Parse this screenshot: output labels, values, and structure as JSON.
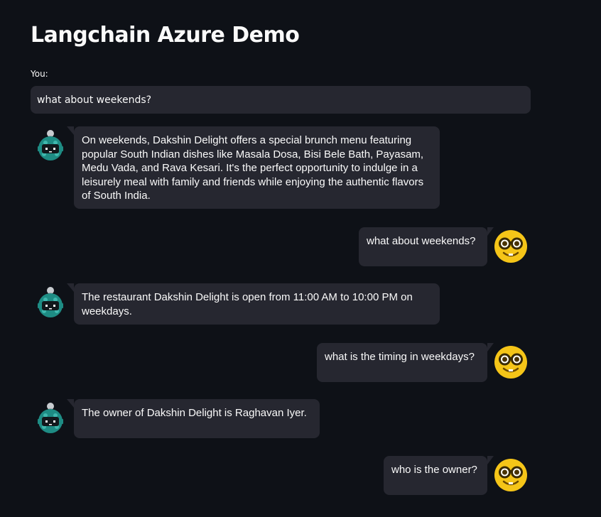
{
  "app": {
    "title": "Langchain Azure Demo"
  },
  "input": {
    "label": "You:",
    "value": "what about weekends?"
  },
  "colors": {
    "background": "#0e1117",
    "bubble": "#262730",
    "text": "#fafafa",
    "bot_avatar": "#1e8c84",
    "user_avatar": "#f5c518"
  },
  "messages": [
    {
      "role": "bot",
      "avatar_icon": "robot-icon",
      "text": "On weekends, Dakshin Delight offers a special brunch menu featuring popular South Indian dishes like Masala Dosa, Bisi Bele Bath, Payasam, Medu Vada, and Rava Kesari. It's the perfect opportunity to indulge in a leisurely meal with family and friends while enjoying the authentic flavors of South India."
    },
    {
      "role": "user",
      "avatar_icon": "nerd-face-icon",
      "text": "what about weekends?"
    },
    {
      "role": "bot",
      "avatar_icon": "robot-icon",
      "text": "The restaurant Dakshin Delight is open from 11:00 AM to 10:00 PM on weekdays."
    },
    {
      "role": "user",
      "avatar_icon": "nerd-face-icon",
      "text": "what is the timing in weekdays?"
    },
    {
      "role": "bot",
      "avatar_icon": "robot-icon",
      "text": "The owner of Dakshin Delight is Raghavan Iyer."
    },
    {
      "role": "user",
      "avatar_icon": "nerd-face-icon",
      "text": "who is the owner?"
    }
  ]
}
